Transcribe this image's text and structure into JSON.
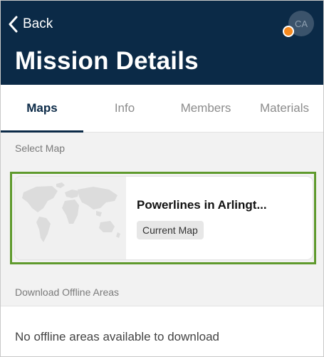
{
  "header": {
    "back_label": "Back",
    "title": "Mission Details",
    "avatar_initials": "CA",
    "status_color": "#f5891f",
    "background_color": "#0b2a47"
  },
  "tabs": [
    {
      "label": "Maps",
      "active": true
    },
    {
      "label": "Info",
      "active": false
    },
    {
      "label": "Members",
      "active": false
    },
    {
      "label": "Materials",
      "active": false
    }
  ],
  "select_map": {
    "section_label": "Select Map",
    "card": {
      "name": "Powerlines in Arlingt...",
      "badge": "Current Map",
      "thumbnail": "world-map-thumbnail",
      "highlight_color": "#5f9a2d"
    }
  },
  "offline": {
    "section_label": "Download Offline Areas",
    "empty_message": "No offline areas available to download"
  }
}
